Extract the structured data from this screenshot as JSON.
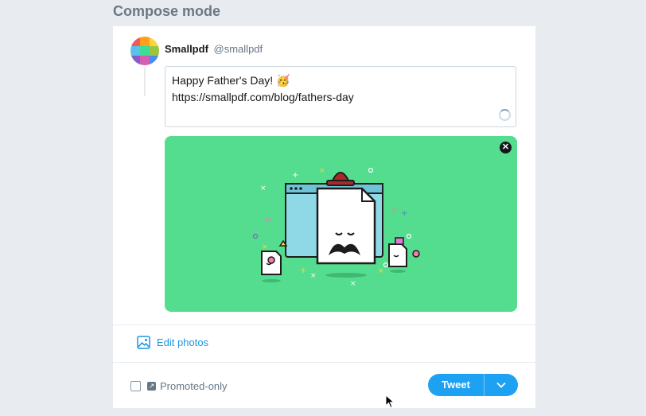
{
  "page": {
    "title": "Compose mode"
  },
  "author": {
    "name": "Smallpdf",
    "handle": "@smallpdf"
  },
  "compose": {
    "line1": "Happy Father's Day! 🥳",
    "line2": "https://smallpdf.com/blog/fathers-day"
  },
  "media": {
    "close_icon": "close-icon",
    "background": "#54dd8e"
  },
  "actions": {
    "edit_photos_label": "Edit photos",
    "promoted_only_label": "Promoted-only",
    "tweet_label": "Tweet"
  },
  "colors": {
    "accent": "#1da1f2",
    "link": "#1b95e0"
  }
}
